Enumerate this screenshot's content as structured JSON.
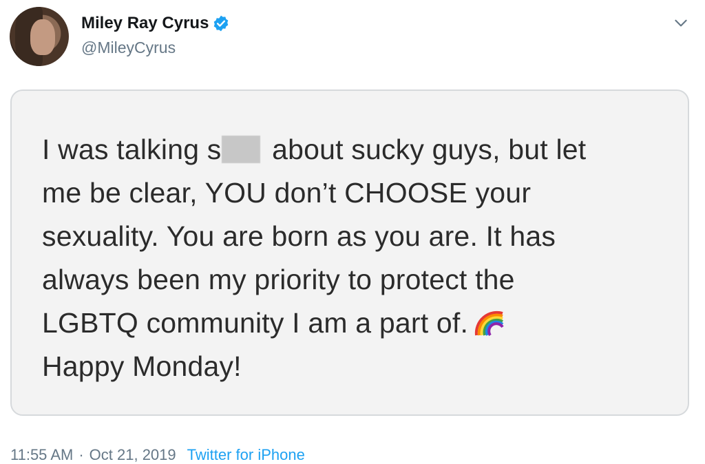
{
  "tweet": {
    "author": {
      "display_name": "Miley Ray Cyrus",
      "handle": "@MileyCyrus",
      "verified": true
    },
    "text": {
      "line1_before": "I was talking s",
      "line1_after": " about sucky guys, but let",
      "rest": "me be clear, YOU don’t CHOOSE your\nsexuality. You are born as you are. It has\nalways been my priority to protect the",
      "line5": "LGBTQ community I am a part of.",
      "line6": "Happy Monday!"
    },
    "emoji": "rainbow-icon",
    "footer": {
      "time": "11:55 AM",
      "separator": "·",
      "date": "Oct 21, 2019",
      "source": "Twitter for iPhone"
    }
  },
  "colors": {
    "verified_blue": "#1da1f2",
    "handle_gray": "#657786",
    "card_bg": "#f3f3f3",
    "link_blue": "#1da1f2"
  }
}
